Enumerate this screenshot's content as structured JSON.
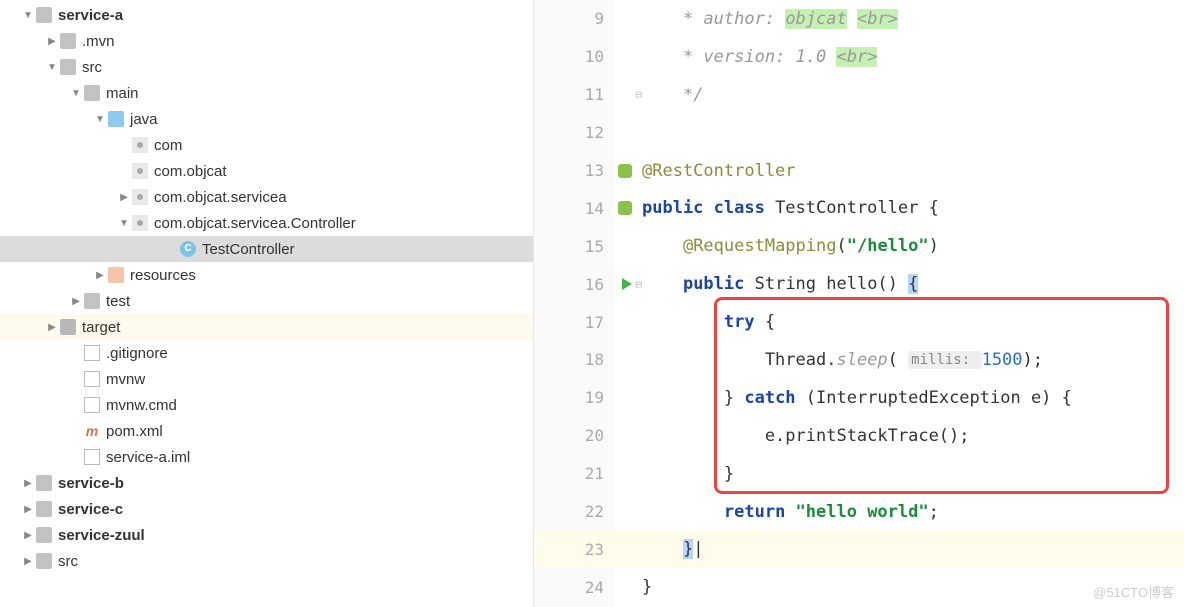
{
  "tree": {
    "items": [
      {
        "indent": 1,
        "arrow": "down",
        "icon": "folder-grey",
        "label": "service-a",
        "bold": true
      },
      {
        "indent": 2,
        "arrow": "right",
        "icon": "folder-grey",
        "label": ".mvn"
      },
      {
        "indent": 2,
        "arrow": "down",
        "icon": "folder-grey",
        "label": "src"
      },
      {
        "indent": 3,
        "arrow": "down",
        "icon": "folder-grey",
        "label": "main"
      },
      {
        "indent": 4,
        "arrow": "down",
        "icon": "folder-blue",
        "label": "java"
      },
      {
        "indent": 5,
        "arrow": "",
        "icon": "pkg",
        "label": "com"
      },
      {
        "indent": 5,
        "arrow": "",
        "icon": "pkg",
        "label": "com.objcat"
      },
      {
        "indent": 5,
        "arrow": "right",
        "icon": "pkg",
        "label": "com.objcat.servicea"
      },
      {
        "indent": 5,
        "arrow": "down",
        "icon": "pkg",
        "label": "com.objcat.servicea.Controller"
      },
      {
        "indent": 7,
        "arrow": "",
        "icon": "class",
        "label": "TestController",
        "selected": true
      },
      {
        "indent": 4,
        "arrow": "right",
        "icon": "folder-pink",
        "label": "resources"
      },
      {
        "indent": 3,
        "arrow": "right",
        "icon": "folder-grey",
        "label": "test"
      },
      {
        "indent": 2,
        "arrow": "right",
        "icon": "folder-dark",
        "label": "target",
        "target": true
      },
      {
        "indent": 3,
        "arrow": "",
        "icon": "file",
        "label": ".gitignore"
      },
      {
        "indent": 3,
        "arrow": "",
        "icon": "file",
        "label": "mvnw"
      },
      {
        "indent": 3,
        "arrow": "",
        "icon": "file",
        "label": "mvnw.cmd"
      },
      {
        "indent": 3,
        "arrow": "",
        "icon": "maven",
        "label": "pom.xml"
      },
      {
        "indent": 3,
        "arrow": "",
        "icon": "iml",
        "label": "service-a.iml"
      },
      {
        "indent": 1,
        "arrow": "right",
        "icon": "folder-grey",
        "label": "service-b",
        "bold": true
      },
      {
        "indent": 1,
        "arrow": "right",
        "icon": "folder-grey",
        "label": "service-c",
        "bold": true
      },
      {
        "indent": 1,
        "arrow": "right",
        "icon": "folder-grey",
        "label": "service-zuul",
        "bold": true
      },
      {
        "indent": 1,
        "arrow": "right",
        "icon": "folder-grey",
        "label": "src"
      }
    ]
  },
  "editor": {
    "lines": [
      {
        "n": 9,
        "tokens": [
          {
            "t": "    ",
            "c": ""
          },
          {
            "t": "* author: ",
            "c": "comment"
          },
          {
            "t": "objcat",
            "c": "comment hl-green"
          },
          {
            "t": " ",
            "c": "comment"
          },
          {
            "t": "<br>",
            "c": "comment hl-green"
          }
        ]
      },
      {
        "n": 10,
        "tokens": [
          {
            "t": "    ",
            "c": ""
          },
          {
            "t": "* version: 1.0 ",
            "c": "comment"
          },
          {
            "t": "<br>",
            "c": "comment hl-green"
          }
        ]
      },
      {
        "n": 11,
        "fold": "up",
        "tokens": [
          {
            "t": "    ",
            "c": ""
          },
          {
            "t": "*/",
            "c": "comment"
          }
        ]
      },
      {
        "n": 12,
        "tokens": []
      },
      {
        "n": 13,
        "mark": "spring",
        "tokens": [
          {
            "t": "@RestController",
            "c": "anno"
          }
        ]
      },
      {
        "n": 14,
        "mark": "spring",
        "tokens": [
          {
            "t": "public class ",
            "c": "kw"
          },
          {
            "t": "TestController {",
            "c": ""
          }
        ]
      },
      {
        "n": 15,
        "tokens": [
          {
            "t": "    ",
            "c": ""
          },
          {
            "t": "@RequestMapping",
            "c": "anno"
          },
          {
            "t": "(",
            "c": ""
          },
          {
            "t": "\"/hello\"",
            "c": "str"
          },
          {
            "t": ")",
            "c": ""
          }
        ]
      },
      {
        "n": 16,
        "mark": "run",
        "fold": "down",
        "tokens": [
          {
            "t": "    ",
            "c": ""
          },
          {
            "t": "public ",
            "c": "kw"
          },
          {
            "t": "String hello() ",
            "c": ""
          },
          {
            "t": "{",
            "c": "cur-blue"
          }
        ]
      },
      {
        "n": 17,
        "tokens": [
          {
            "t": "        ",
            "c": ""
          },
          {
            "t": "try ",
            "c": "kw"
          },
          {
            "t": "{",
            "c": ""
          }
        ]
      },
      {
        "n": 18,
        "tokens": [
          {
            "t": "            Thread.",
            "c": ""
          },
          {
            "t": "sleep",
            "c": "comment"
          },
          {
            "t": "( ",
            "c": ""
          },
          {
            "t": "millis: ",
            "c": "hint"
          },
          {
            "t": "1500",
            "c": "num"
          },
          {
            "t": ");",
            "c": ""
          }
        ]
      },
      {
        "n": 19,
        "tokens": [
          {
            "t": "        } ",
            "c": ""
          },
          {
            "t": "catch ",
            "c": "kw"
          },
          {
            "t": "(InterruptedException e) {",
            "c": ""
          }
        ]
      },
      {
        "n": 20,
        "tokens": [
          {
            "t": "            e.printStackTrace();",
            "c": ""
          }
        ]
      },
      {
        "n": 21,
        "tokens": [
          {
            "t": "        }",
            "c": ""
          }
        ]
      },
      {
        "n": 22,
        "tokens": [
          {
            "t": "        ",
            "c": ""
          },
          {
            "t": "return ",
            "c": "kw"
          },
          {
            "t": "\"hello world\"",
            "c": "str"
          },
          {
            "t": ";",
            "c": ""
          }
        ]
      },
      {
        "n": 23,
        "fold": "up",
        "highlight": true,
        "tokens": [
          {
            "t": "    ",
            "c": ""
          },
          {
            "t": "}",
            "c": "cur-blue"
          },
          {
            "t": "|",
            "c": ""
          }
        ]
      },
      {
        "n": 24,
        "tokens": [
          {
            "t": "}",
            "c": ""
          }
        ]
      }
    ]
  },
  "watermark": "@51CTO博客"
}
